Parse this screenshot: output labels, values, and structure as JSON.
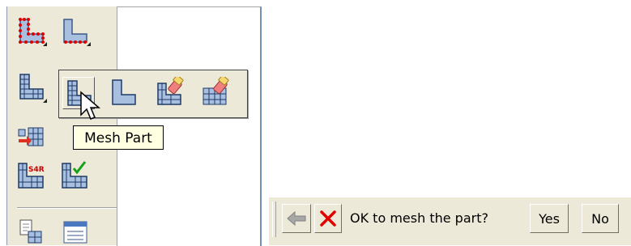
{
  "toolbox": {
    "tools": [
      {
        "icon": "seed-part-icon"
      },
      {
        "icon": "seed-edges-icon"
      },
      {
        "icon": "assign-mesh-controls-icon"
      },
      {
        "icon": "assign-element-type-icon"
      },
      {
        "icon": "verify-mesh-icon"
      },
      {
        "icon": "query-icon"
      },
      {
        "icon": "layout-icon"
      }
    ],
    "flyout": [
      {
        "icon": "mesh-part-icon",
        "selected": true
      },
      {
        "icon": "mesh-region-icon"
      },
      {
        "icon": "delete-part-mesh-icon"
      },
      {
        "icon": "delete-region-mesh-icon"
      }
    ]
  },
  "tooltip": {
    "text": "Mesh Part"
  },
  "prompt": {
    "question": "OK to mesh the part?",
    "yes_label": "Yes",
    "no_label": "No",
    "back_icon": "back-arrow-icon",
    "cancel_icon": "red-x-icon"
  },
  "colors": {
    "panel_bg": "#ece9d8",
    "tooltip_bg": "#ffffe1",
    "cancel_red": "#e00000",
    "part_blue": "#a8bfe0"
  }
}
